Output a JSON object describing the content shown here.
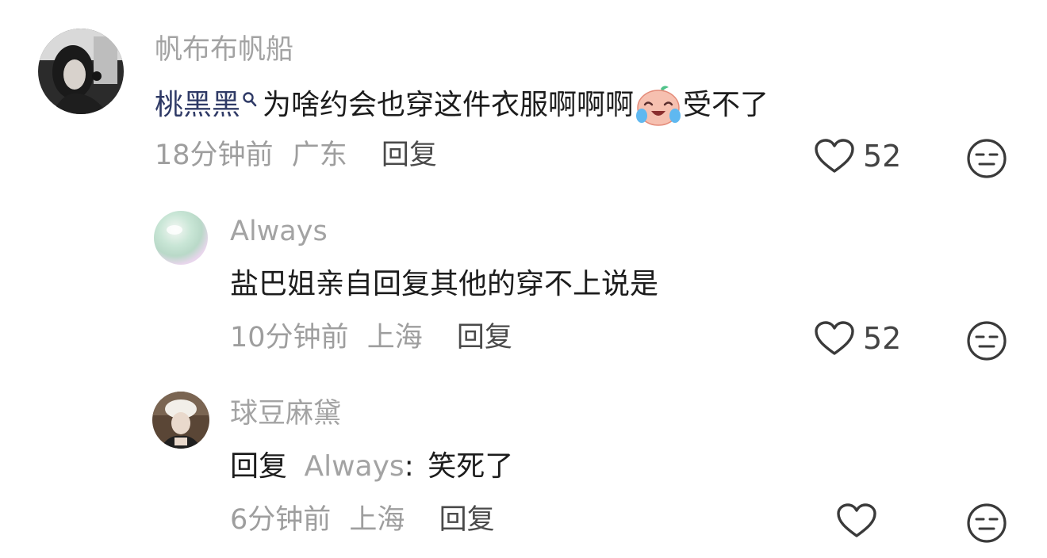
{
  "comments": [
    {
      "username": "帆布布帆船",
      "mention": "桃黑黑",
      "text": "为啥约会也穿这件衣服啊啊啊",
      "text_suffix": "受不了",
      "time": "18分钟前",
      "location": "广东",
      "reply_label": "回复",
      "likes": "52"
    },
    {
      "username": "Always",
      "text": "盐巴姐亲自回复其他的穿不上说是",
      "time": "10分钟前",
      "location": "上海",
      "reply_label": "回复",
      "likes": "52"
    },
    {
      "username": "球豆麻黛",
      "reply_prefix": "回复",
      "reply_to": "Always",
      "reply_colon": ":",
      "text": "笑死了",
      "time": "6分钟前",
      "location": "上海",
      "reply_label": "回复",
      "likes": ""
    }
  ],
  "icons": {
    "like": "heart-outline-icon",
    "dislike": "neutral-face-icon",
    "mention_search": "search-icon",
    "emoji": "crying-laugh-emoji"
  },
  "colors": {
    "name_gray": "#a3a3a3",
    "mention_blue": "#2f3a66",
    "meta_gray": "#9e9e9e"
  }
}
